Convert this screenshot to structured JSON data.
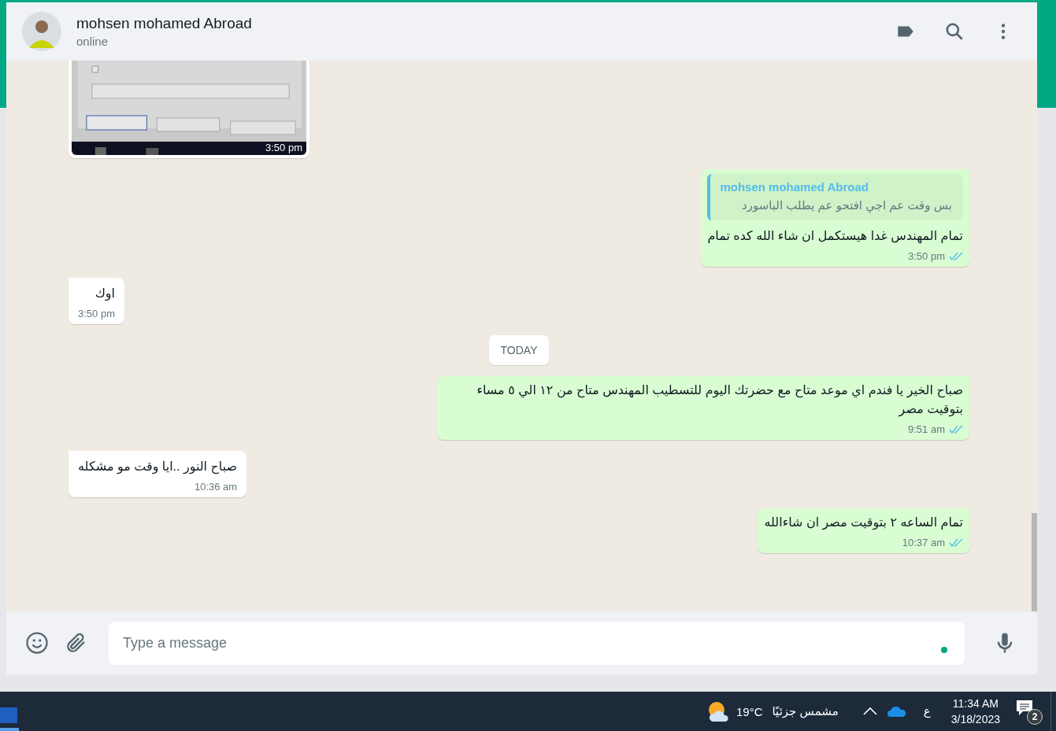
{
  "header": {
    "name": "mohsen mohamed Abroad",
    "status": "online"
  },
  "messages": [
    {
      "outgoing": false,
      "time": "3:50 pm"
    },
    {
      "kind": "text",
      "outgoing": true,
      "quote": {
        "author": "mohsen mohamed Abroad",
        "text": "بس وقت عم اجي افتحو عم يطلب الباسورد"
      },
      "text": "تمام المهندس غدا هيستكمل ان شاء الله كده تمام",
      "time": "3:50 pm",
      "read": true
    },
    {
      "kind": "text",
      "outgoing": false,
      "text": "اوك",
      "time": "3:50 pm"
    },
    {
      "kind": "divider",
      "text": "TODAY"
    },
    {
      "kind": "text",
      "outgoing": true,
      "text": "صباح الخير يا فندم اي موعد متاح مع حضرتك اليوم للتسطيب المهندس متاح من ١٢ الي ٥ مساء بتوقيت مصر",
      "time": "9:51 am",
      "read": true
    },
    {
      "kind": "text",
      "outgoing": false,
      "text": "صباح النور ..ايا وقت مو مشكله",
      "time": "10:36 am"
    },
    {
      "kind": "text",
      "outgoing": true,
      "text": "تمام الساعه ٢ بتوقيت مصر ان شاءالله",
      "time": "10:37 am",
      "read": true
    }
  ],
  "composer": {
    "placeholder": "Type a message"
  },
  "taskbar": {
    "temperature": "19°C",
    "weather": "مشمس جزئيًا",
    "language": "ع",
    "time": "11:34 AM",
    "date": "3/18/2023",
    "notifications": "2"
  }
}
